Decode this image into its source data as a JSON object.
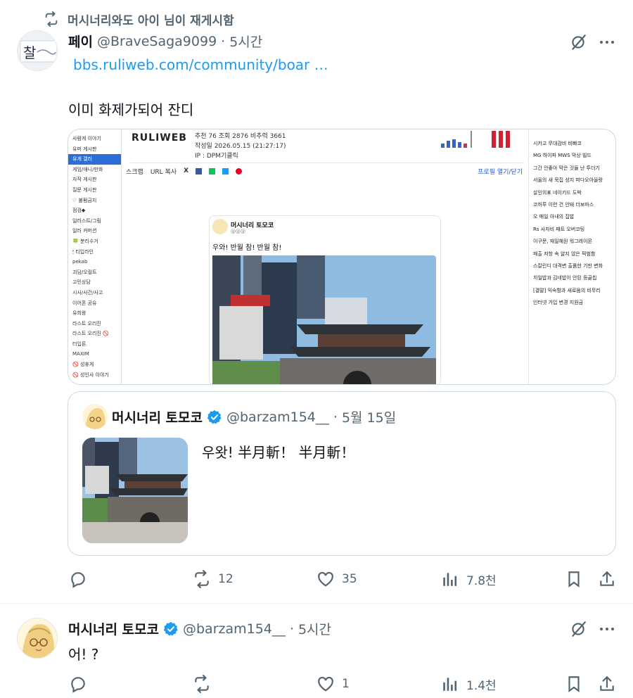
{
  "repost": {
    "text": "머시너리와도  아이 님이 재게시함"
  },
  "post1": {
    "display_name": "페이",
    "handle": "@BraveSaga9099",
    "sep": "·",
    "time": "5시간",
    "link": "bbs.ruliweb.com/community/boar  …",
    "text": "이미 화제가되어 잔디",
    "avatar_text": "찰"
  },
  "screenshot": {
    "logo": "RULIWEB",
    "stats_line": "추천 76   조회 2876   비추력 3661",
    "date_line": "작성일 2026.05.15 (21:27:17)",
    "ip_line": "IP : DPM기클릭",
    "toolbar": [
      "스크랩",
      "URL 복사"
    ],
    "toolbar_right": "프로필 열기/닫기",
    "sidebar": [
      "사람게 이야기",
      "유머 게시판",
      "유게 갤러",
      "게임/애니/만화",
      "자작 게시판",
      "질문 게시판",
      "♡ 불펌금지",
      "점검◆",
      "일러스트/그림",
      "일러 커머션",
      "🍀 분리수거",
      "🕯 티입라인",
      "pekab",
      "괴담/오컬트",
      "고민상담",
      "시사/사건/사고",
      "이어폰 공유",
      "유희왕",
      "라스트 오리진",
      "라스트 오리진 🚫",
      "터입론",
      "MAXIM",
      "🚫 성휴게",
      "🚫 성인사 이야기"
    ],
    "right_list": [
      "시카고 무대감비 비빠코",
      "MG 하이파 MWS 막상 빌드",
      "그간 안좋아 막은 것들 난 투더기",
      "서울의 새 묵집 성지 떠다오아울랑",
      "살인의표 네이키드 도박",
      "코허루 이런 건 안돼 더보마스",
      "오 매일 아내의 집밥",
      "Rs 사자비 패트 오버코팅",
      "이구문, 재일혜원 워그레이몬",
      "매출 저항 속 알지 않은 픽범함",
      "스칼린디 대격변 출품한 기만 변화",
      "치일밥과 김네밥이 안된 등골칩",
      "[결말] 익숙함과 새로움의 비무리",
      "인터넷 가입 변경 지원금"
    ],
    "embed": {
      "name": "머시너리 토모코",
      "handle": "@@@",
      "text": "우와! 반월 참! 반월 참!"
    }
  },
  "quote": {
    "display_name": "머시너리 토모코",
    "handle": "@barzam154__",
    "sep": "·",
    "date": "5월 15일",
    "text": "우왓! 半月斬！ 半月斬！"
  },
  "actions1": {
    "reply": "",
    "repost": "12",
    "like": "35",
    "views": "7.8천"
  },
  "post2": {
    "display_name": "머시너리 토모코",
    "handle": "@barzam154__",
    "sep": "·",
    "time": "5시간",
    "text": "어! ?"
  },
  "actions2": {
    "reply": "",
    "repost": "",
    "like": "1",
    "views": "1.4천"
  },
  "colors": {
    "accent": "#1d9bf0",
    "muted": "#536471",
    "text": "#0f1419",
    "border": "#cfd9de"
  }
}
